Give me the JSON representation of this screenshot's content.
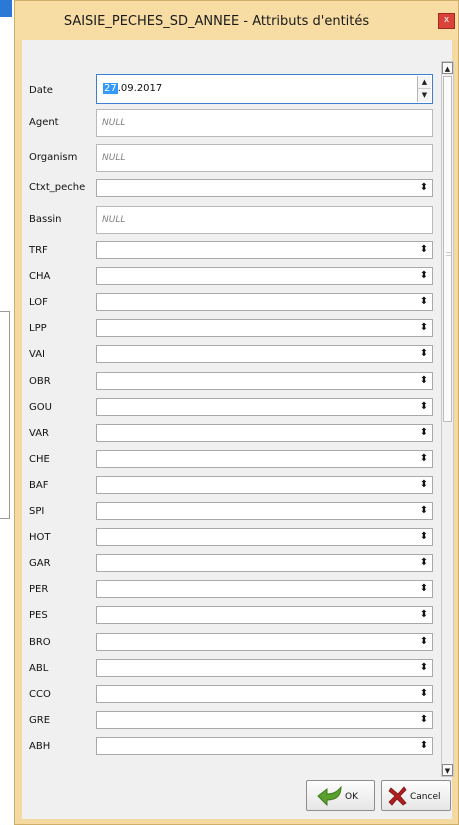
{
  "window": {
    "title": "SAISIE_PECHES_SD_ANNEE - Attributs d'entités",
    "close_glyph": "x"
  },
  "fields": {
    "date": {
      "label": "Date",
      "value_selected": "27",
      "value_rest": ".09.2017",
      "spin_up": "▲",
      "spin_down": "▼"
    },
    "agent": {
      "label": "Agent",
      "value": "NULL"
    },
    "organism": {
      "label": "Organism",
      "value": "NULL"
    },
    "ctxt_peche": {
      "label": "Ctxt_peche",
      "value": ""
    },
    "bassin": {
      "label": "Bassin",
      "value": "NULL"
    }
  },
  "combo_arrow": "⬍",
  "species": [
    "TRF",
    "CHA",
    "LOF",
    "LPP",
    "VAI",
    "OBR",
    "GOU",
    "VAR",
    "CHE",
    "BAF",
    "SPI",
    "HOT",
    "GAR",
    "PER",
    "PES",
    "BRO",
    "ABL",
    "CCO",
    "GRE",
    "ABH"
  ],
  "scrollbar": {
    "up": "▲",
    "down": "▼"
  },
  "buttons": {
    "ok": "OK",
    "cancel": "Cancel"
  },
  "colors": {
    "titlebar": "#f7dca3",
    "accent": "#3399ff",
    "close": "#d9443a"
  }
}
